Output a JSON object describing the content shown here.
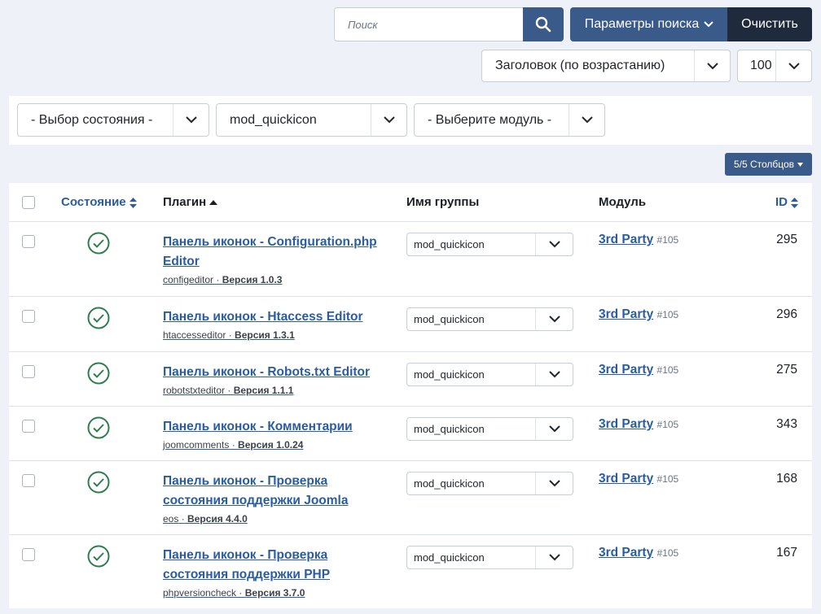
{
  "search": {
    "placeholder": "Поиск",
    "params_label": "Параметры поиска",
    "clear_label": "Очистить"
  },
  "ordering": {
    "selected": "Заголовок (по возрастанию)"
  },
  "limit": {
    "selected": "100"
  },
  "filters": {
    "state": "- Выбор состояния -",
    "group": "mod_quickicon",
    "module": "- Выберите модуль -"
  },
  "columns_button": "5/5 Столбцов",
  "table": {
    "headers": {
      "state": "Состояние",
      "plugin": "Плагин",
      "group": "Имя группы",
      "module": "Модуль",
      "id": "ID"
    },
    "rows": [
      {
        "title": "Панель иконок - Configuration.php Editor",
        "element": "configeditor",
        "version": "Версия 1.0.3",
        "group": "mod_quickicon",
        "module": "3rd Party",
        "module_num": "#105",
        "id": "295"
      },
      {
        "title": "Панель иконок - Htaccess Editor",
        "element": "htaccesseditor",
        "version": "Версия 1.3.1",
        "group": "mod_quickicon",
        "module": "3rd Party",
        "module_num": "#105",
        "id": "296"
      },
      {
        "title": "Панель иконок - Robots.txt Editor",
        "element": "robotstxteditor",
        "version": "Версия 1.1.1",
        "group": "mod_quickicon",
        "module": "3rd Party",
        "module_num": "#105",
        "id": "275"
      },
      {
        "title": "Панель иконок - Комментарии",
        "element": "joomcomments",
        "version": "Версия 1.0.24",
        "group": "mod_quickicon",
        "module": "3rd Party",
        "module_num": "#105",
        "id": "343"
      },
      {
        "title": "Панель иконок - Проверка состояния поддержки Joomla",
        "element": "eos",
        "version": "Версия 4.4.0",
        "group": "mod_quickicon",
        "module": "3rd Party",
        "module_num": "#105",
        "id": "168"
      },
      {
        "title": "Панель иконок - Проверка состояния поддержки PHP",
        "element": "phpversioncheck",
        "version": "Версия 3.7.0",
        "group": "mod_quickicon",
        "module": "3rd Party",
        "module_num": "#105",
        "id": "167"
      }
    ]
  },
  "colors": {
    "primary": "#3a5a8a",
    "dark": "#1f2a3c",
    "link": "#2a5d9f",
    "success": "#2e7d4f"
  }
}
